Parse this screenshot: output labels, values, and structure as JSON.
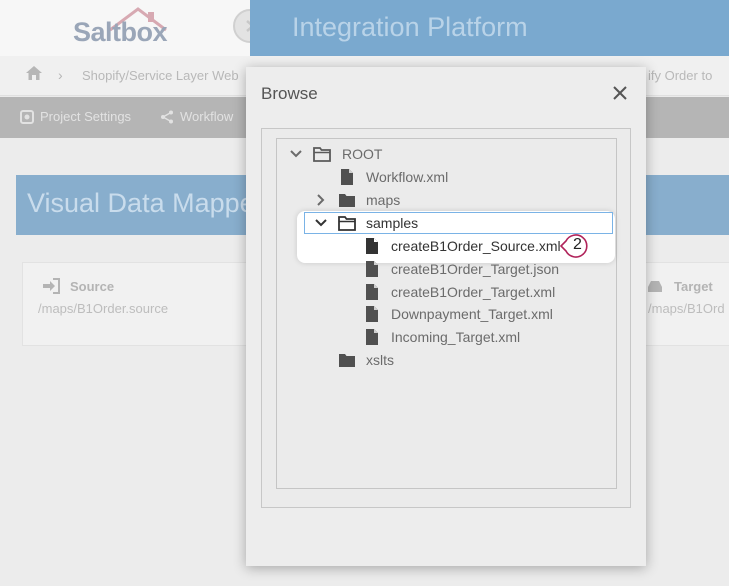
{
  "header": {
    "logo_text": "Saltbox",
    "app_title": "Integration Platform"
  },
  "breadcrumb": {
    "item1": "Shopify/Service Layer Web",
    "item2": "ify Order to"
  },
  "toolbar": {
    "project_settings": "Project Settings",
    "workflow": "Workflow"
  },
  "main": {
    "mapper_title": "Visual Data Mapper",
    "source_label": "Source",
    "source_path": "/maps/B1Order.source",
    "target_label": "Target",
    "target_path": "/maps/B1Ord"
  },
  "dialog": {
    "title": "Browse",
    "tree": {
      "root": "ROOT",
      "workflow_xml": "Workflow.xml",
      "maps": "maps",
      "samples": "samples",
      "files": [
        "createB1Order_Source.xml",
        "createB1Order_Target.json",
        "createB1Order_Target.xml",
        "Downpayment_Target.xml",
        "Incoming_Target.xml"
      ],
      "xslts": "xslts"
    }
  },
  "callout": {
    "number": "2",
    "color": "#b0235a"
  },
  "colors": {
    "title_band": "#7aa9cf",
    "selection_border": "#7ab3e6"
  }
}
